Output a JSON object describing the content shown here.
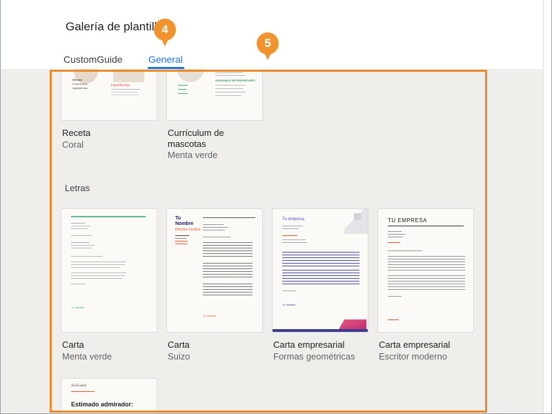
{
  "header": {
    "title": "Galería de plantillas",
    "tabs": [
      {
        "label": "CustomGuide",
        "selected": false
      },
      {
        "label": "General",
        "selected": true
      }
    ]
  },
  "callouts": {
    "tab_badge": "4",
    "gallery_badge": "5",
    "color": "#f0922e"
  },
  "accent": "#1a73e8",
  "gallery": {
    "top_cards": [
      {
        "name": "Receta",
        "subtitle": "Coral",
        "thumb_text": {
          "line1": "Directo",
          "line2": "Coral:Fabric",
          "line3": "Ingredientes",
          "heading": "Ingredientes"
        }
      },
      {
        "name": "Currículum de mascotas",
        "name_line1": "Currículum de",
        "name_line2": "mascotas",
        "subtitle": "Menta verde",
        "thumb_text": {
          "heading": "ADORABLE DE PROPIETARIO"
        }
      }
    ],
    "letters_section": {
      "title": "Letras",
      "cards": [
        {
          "name": "Carta",
          "subtitle": "Menta verde",
          "thumb_text": {
            "sign": "Tu nombre"
          }
        },
        {
          "name": "Carta",
          "subtitle": "Suizo",
          "thumb_text": {
            "name1": "Tu",
            "name2": "Nombre",
            "role": "Director creativo",
            "sign": "Tu nombre"
          }
        },
        {
          "name": "Carta empresarial",
          "subtitle": "Formas geométricas",
          "thumb_text": {
            "company": "Tu empresa",
            "sign": "Tu nombre"
          }
        },
        {
          "name": "Carta empresarial",
          "subtitle": "Escritor moderno",
          "thumb_text": {
            "company": "TU EMPRESA"
          }
        }
      ]
    },
    "bottom_card": {
      "thumb_text": {
        "logo": "Tu Escuela",
        "greeting": "Estimado admirador:"
      }
    }
  }
}
